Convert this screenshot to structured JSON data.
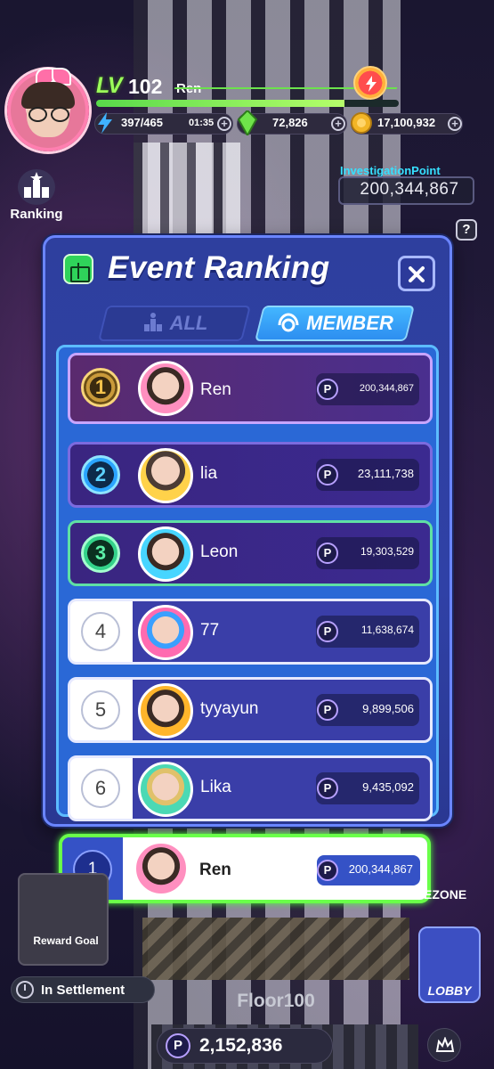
{
  "hud": {
    "level_prefix": "LV",
    "level": "102",
    "player_name": "Ren",
    "energy": "397/465",
    "timer": "01:35",
    "gems": "72,826",
    "coins": "17,100,932",
    "ranking_label": "Ranking",
    "investigation_title": "InvestigationPoint",
    "investigation_value": "200,344,867",
    "help_label": "?"
  },
  "modal": {
    "title": "Event Ranking",
    "tabs": [
      {
        "label": "ALL",
        "active": false
      },
      {
        "label": "MEMBER",
        "active": true
      }
    ],
    "rows": [
      {
        "rank": "1",
        "name": "Ren",
        "score": "200,344,867"
      },
      {
        "rank": "2",
        "name": "lia",
        "score": "23,111,738"
      },
      {
        "rank": "3",
        "name": "Leon",
        "score": "19,303,529"
      },
      {
        "rank": "4",
        "name": "77",
        "score": "11,638,674"
      },
      {
        "rank": "5",
        "name": "tyyayun",
        "score": "9,899,506"
      },
      {
        "rank": "6",
        "name": "Lika",
        "score": "9,435,092"
      }
    ],
    "self_row": {
      "rank": "1",
      "name": "Ren",
      "score": "200,344,867"
    },
    "point_symbol": "P"
  },
  "bottom": {
    "reward_goal_label": "Reward Goal",
    "settlement_label": "In Settlement",
    "floor_label": "Floor100",
    "lobby_label": "LOBBY",
    "zone_label": "EZONE",
    "points": "2,152,836",
    "point_symbol": "P"
  },
  "colors": {
    "accent_green": "#9cff5a",
    "modal_blue": "#3041a6",
    "member_tab": "#43b6ff",
    "highlight_border": "#6aff4a"
  }
}
